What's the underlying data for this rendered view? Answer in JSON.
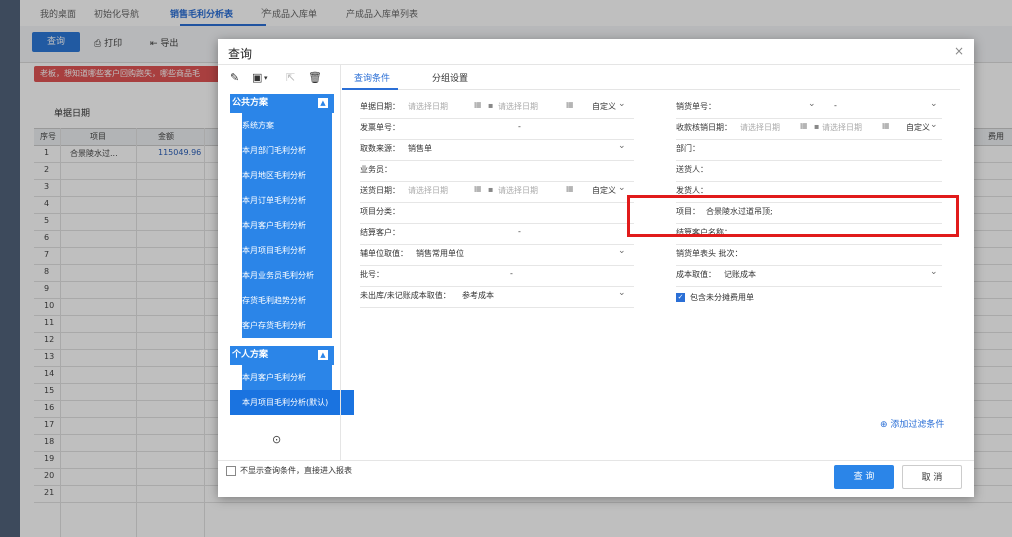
{
  "tabs": [
    {
      "label": "我的桌面"
    },
    {
      "label": "初始化导航"
    },
    {
      "label": "销售毛利分析表",
      "active": true
    },
    {
      "label": "产成品入库单"
    },
    {
      "label": "产成品入库单列表"
    }
  ],
  "tab_close": "×",
  "toolbar": {
    "query_label": "查询",
    "print_label": "打印",
    "export_label": "导出"
  },
  "notice_text": "老板，想知道哪些客户回购跑失，哪些商品毛",
  "background": {
    "date_label": "单据日期",
    "headers": [
      "序号",
      "项目",
      "金额"
    ],
    "extra_header": "费用",
    "row_numbers": [
      "1",
      "2",
      "3",
      "4",
      "5",
      "6",
      "7",
      "8",
      "9",
      "10",
      "11",
      "12",
      "13",
      "14",
      "15",
      "16",
      "17",
      "18",
      "19",
      "20",
      "21"
    ],
    "first_row": {
      "item": "合景陵水过...",
      "amount": "115049.96"
    }
  },
  "dialog": {
    "title": "查询",
    "close": "×",
    "icons": {
      "edit": "✎",
      "save": "▣",
      "export": "⇱",
      "delete": "🗑"
    },
    "public_scheme": "公共方案",
    "public_items": [
      "系统方案",
      "本月部门毛利分析",
      "本月地区毛利分析",
      "本月订单毛利分析",
      "本月客户毛利分析",
      "本月项目毛利分析",
      "本月业务员毛利分析",
      "存货毛利趋势分析",
      "客户存货毛利分析"
    ],
    "personal_scheme": "个人方案",
    "personal_items": [
      "本月客户毛利分析",
      "本月项目毛利分析(默认)"
    ],
    "collapse_icon": "▲",
    "back_icon": "◀",
    "tab_conditions": "查询条件",
    "tab_group": "分组设置",
    "left_fields": {
      "doc_date": {
        "label": "单据日期：",
        "ph1": "请选择日期",
        "ph2": "请选择日期",
        "mode": "自定义"
      },
      "invoice_no": {
        "label": "发票单号：",
        "value": "-"
      },
      "source": {
        "label": "取数来源：",
        "value": "销售单"
      },
      "salesman": {
        "label": "业务员："
      },
      "delivery_date": {
        "label": "送货日期：",
        "ph1": "请选择日期",
        "ph2": "请选择日期",
        "mode": "自定义"
      },
      "category": {
        "label": "项目分类："
      },
      "settle_customer": {
        "label": "结算客户：",
        "value": "-"
      },
      "unit": {
        "label": "辅单位取值：",
        "value": "销售常用单位"
      },
      "batch": {
        "label": "批号：",
        "value": "-"
      },
      "cost_value": {
        "label": "未出库/未记账成本取值：",
        "value": "参考成本"
      }
    },
    "right_fields": {
      "sales_no": {
        "label": "销货单号：",
        "value": "-"
      },
      "receipt_date": {
        "label": "收款核销日期：",
        "ph1": "请选择日期",
        "ph2": "请选择日期",
        "mode": "自定义"
      },
      "dept": {
        "label": "部门："
      },
      "delivery_person": {
        "label": "送货人："
      },
      "shipper": {
        "label": "发货人："
      },
      "project": {
        "label": "项目：",
        "value": "合景陵水过道吊顶;"
      },
      "settle_customer_name": {
        "label": "结算客户名称："
      },
      "header_batch": {
        "label": "销货单表头 批次："
      },
      "cost": {
        "label": "成本取值：",
        "value": "记账成本"
      },
      "include_unshared": {
        "label": "包含未分摊费用单"
      }
    },
    "add_filter": "添加过滤条件",
    "skip_note": "不显示查询条件，直接进入报表",
    "ok": "查 询",
    "cancel": "取 消"
  }
}
